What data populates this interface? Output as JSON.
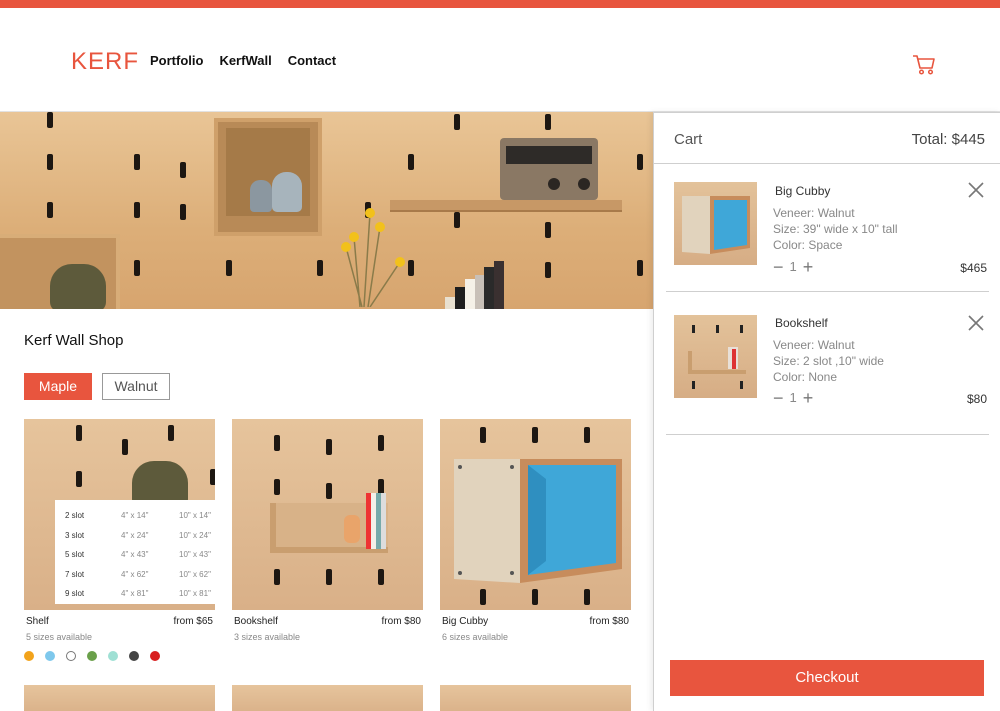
{
  "header": {
    "logo": "KERF",
    "nav": [
      "Portfolio",
      "KerfWall",
      "Contact"
    ]
  },
  "colors": {
    "accent": "#e8553e",
    "blue_interior": "#3fa7d8"
  },
  "shop": {
    "title": "Kerf Wall Shop",
    "veneers": [
      "Maple",
      "Walnut"
    ],
    "selected_veneer": "Maple",
    "products": [
      {
        "name": "Shelf",
        "price": "from $65",
        "sizes": "5 sizes available",
        "size_table": [
          [
            "2 slot",
            "4\" x 14\"",
            "10\" x 14\""
          ],
          [
            "3 slot",
            "4\" x 24\"",
            "10\" x 24\""
          ],
          [
            "5 slot",
            "4\" x 43\"",
            "10\" x 43\""
          ],
          [
            "7 slot",
            "4\" x 62\"",
            "10\" x 62\""
          ],
          [
            "9 slot",
            "4\" x 81\"",
            "10\" x 81\""
          ]
        ],
        "color_swatches": [
          "#f2a31b",
          "#7ec8ec",
          "#ffffff",
          "#6aa04a",
          "#9fe0d4",
          "#444444",
          "#d81e1e"
        ]
      },
      {
        "name": "Bookshelf",
        "price": "from $80",
        "sizes": "3 sizes available"
      },
      {
        "name": "Big Cubby",
        "price": "from $80",
        "sizes": "6 sizes available"
      }
    ]
  },
  "cart": {
    "title": "Cart",
    "total": "Total: $445",
    "items": [
      {
        "name": "Big Cubby",
        "veneer": "Veneer: Walnut",
        "size": "Size: 39\" wide x 10\" tall",
        "color": "Color: Space",
        "quantity": "1",
        "price": "$465"
      },
      {
        "name": "Bookshelf",
        "veneer": "Veneer: Walnut",
        "size": " Size: 2 slot ,10\" wide",
        "color": "Color: None",
        "quantity": "1",
        "price": "$80"
      }
    ],
    "checkout_label": "Checkout"
  }
}
